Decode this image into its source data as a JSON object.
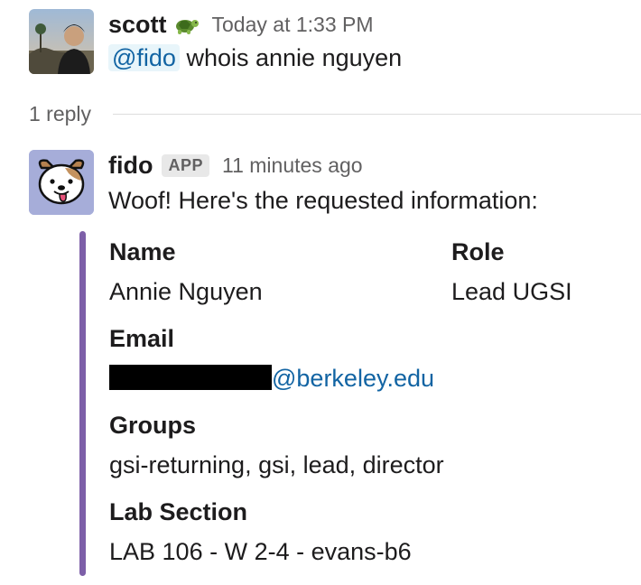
{
  "message_1": {
    "sender": "scott",
    "sender_emoji": "turtle-icon",
    "timestamp": "Today at 1:33 PM",
    "mention": "@fido",
    "text": "whois annie nguyen"
  },
  "thread": {
    "reply_count": "1 reply"
  },
  "message_2": {
    "sender": "fido",
    "badge": "APP",
    "timestamp": "11 minutes ago",
    "text": "Woof! Here's the requested information:",
    "attachment": {
      "bar_color": "#7d5fa8",
      "fields": {
        "name_title": "Name",
        "name_value": "Annie Nguyen",
        "role_title": "Role",
        "role_value": "Lead UGSI",
        "email_title": "Email",
        "email_domain": "@berkeley.edu",
        "groups_title": "Groups",
        "groups_value": "gsi-returning, gsi, lead, director",
        "lab_title": "Lab Section",
        "lab_value": "LAB 106 - W 2-4 - evans-b6"
      }
    }
  },
  "colors": {
    "link": "#1264a3",
    "mention_bg": "#e8f5fa",
    "timestamp": "#616061",
    "attachment_bar": "#7d5fa8"
  }
}
